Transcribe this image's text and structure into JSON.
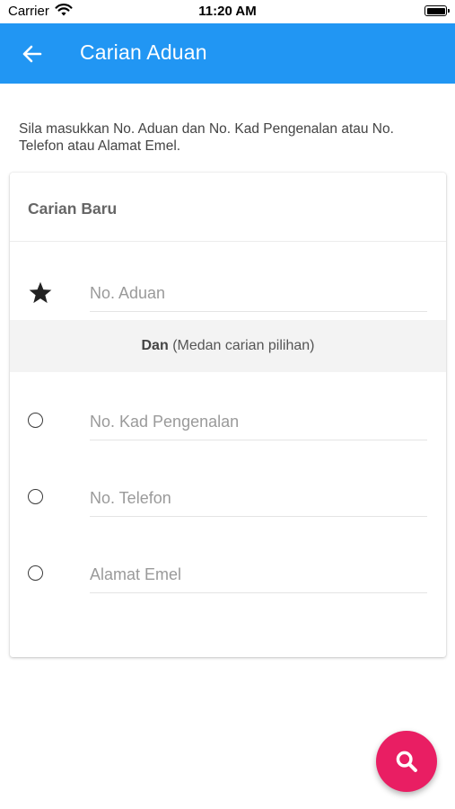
{
  "status_bar": {
    "carrier": "Carrier",
    "time": "11:20 AM",
    "wifi_icon": "wifi-icon",
    "battery_icon": "battery-icon"
  },
  "app_bar": {
    "title": "Carian Aduan",
    "back_icon": "arrow-left-icon",
    "color": "#2196f3"
  },
  "intro_text": "Sila masukkan No. Aduan dan No. Kad Pengenalan atau No. Telefon atau Alamat Emel.",
  "card": {
    "title": "Carian Baru",
    "required_field": {
      "icon": "star-icon",
      "placeholder": "No. Aduan",
      "value": ""
    },
    "separator": {
      "bold": "Dan",
      "note": "(Medan carian pilihan)"
    },
    "optional_fields": [
      {
        "placeholder": "No. Kad Pengenalan",
        "value": "",
        "selected": false
      },
      {
        "placeholder": "No. Telefon",
        "value": "",
        "selected": false
      },
      {
        "placeholder": "Alamat Emel",
        "value": "",
        "selected": false
      }
    ]
  },
  "fab": {
    "icon": "search-icon",
    "color": "#e91e63"
  }
}
